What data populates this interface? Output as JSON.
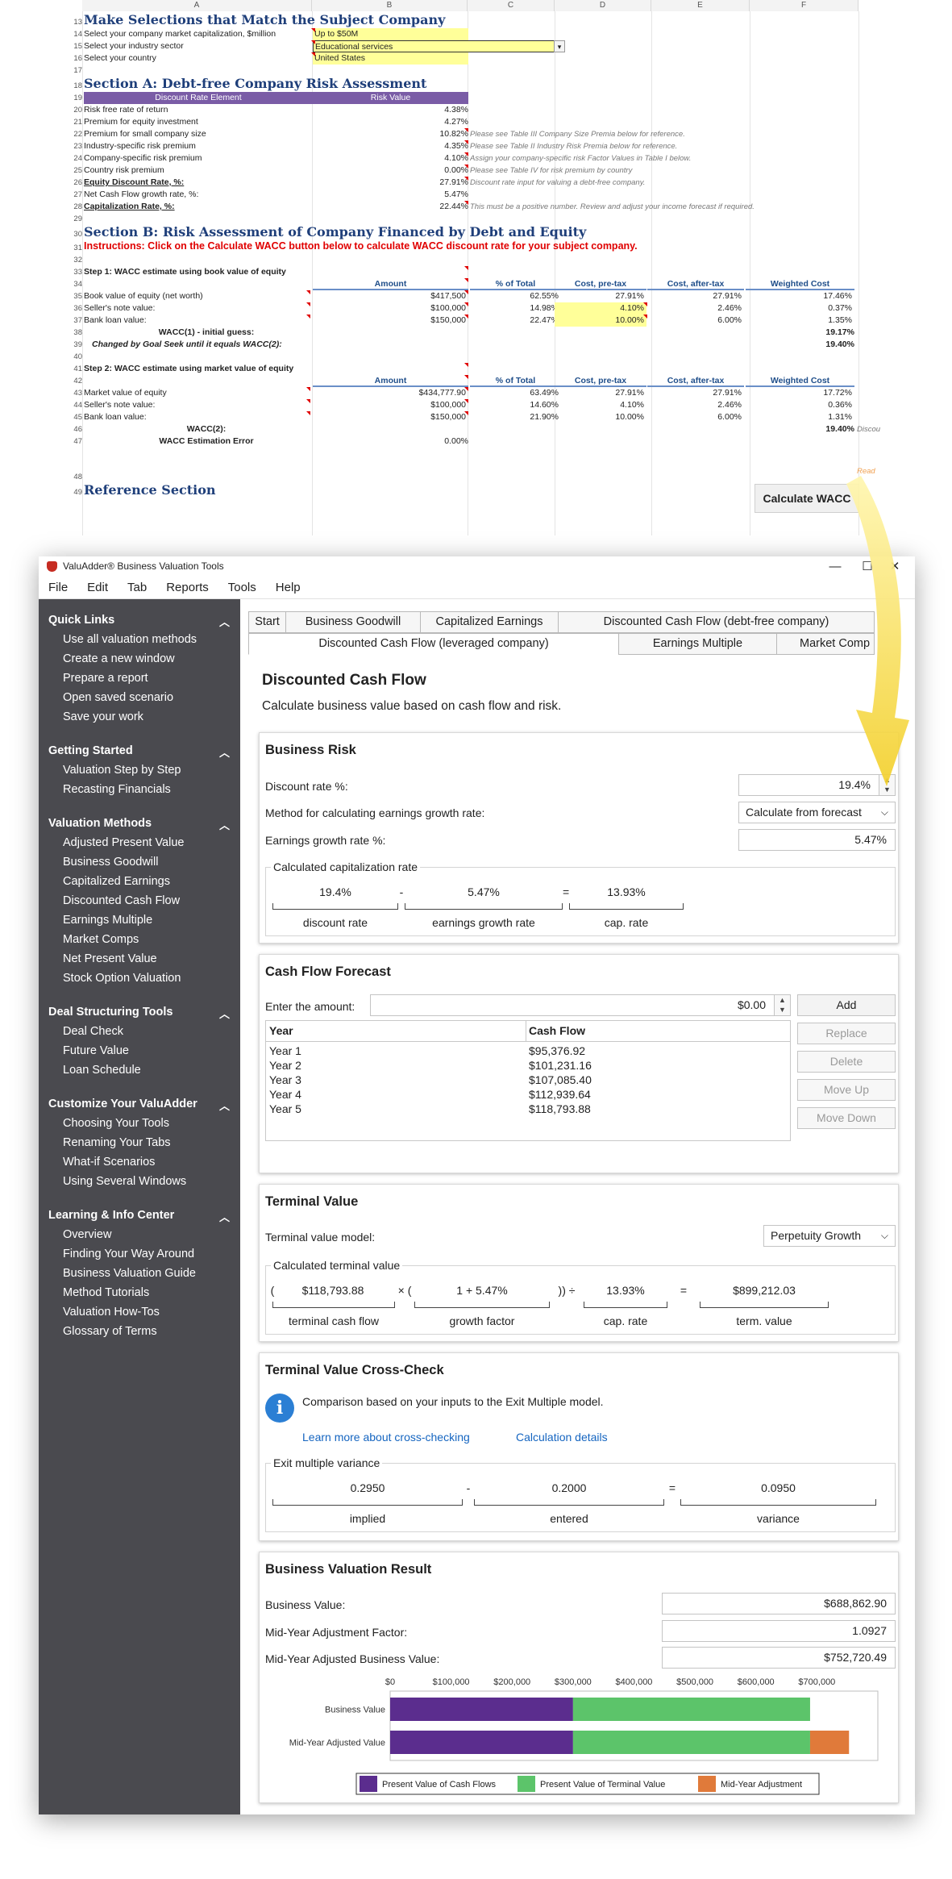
{
  "sheet": {
    "columns": [
      "A",
      "B",
      "C",
      "D",
      "E",
      "F"
    ],
    "rows": [
      {
        "n": "13",
        "a": "Make Selections that Match the Subject Company",
        "kind": "section"
      },
      {
        "n": "14",
        "a": "Select your company market capitalization, $million",
        "b": "Up to $50M",
        "kind": "select"
      },
      {
        "n": "15",
        "a": "Select your industry sector",
        "b": "Educational services",
        "kind": "select"
      },
      {
        "n": "16",
        "a": "Select your country",
        "b": "United States",
        "kind": "select"
      },
      {
        "n": "17",
        "kind": "blank"
      },
      {
        "n": "18",
        "a": "Section A: Debt-free Company Risk Assessment",
        "kind": "section"
      },
      {
        "n": "19",
        "a": "Discount Rate Element",
        "b": "Risk Value",
        "kind": "phdr"
      },
      {
        "n": "20",
        "a": "Risk free rate of return",
        "b": "4.38%",
        "kind": "val"
      },
      {
        "n": "21",
        "a": "Premium for equity investment",
        "b": "4.27%",
        "kind": "val"
      },
      {
        "n": "22",
        "a": "Premium for small company size",
        "b": "10.82%",
        "c": "Please see Table III Company Size Premia below for reference.",
        "kind": "val"
      },
      {
        "n": "23",
        "a": "Industry-specific risk premium",
        "b": "4.35%",
        "c": "Please see Table II Industry Risk Premia below for reference.",
        "kind": "val"
      },
      {
        "n": "24",
        "a": "Company-specific risk premium",
        "b": "4.10%",
        "c": "Assign your company-specific risk Factor Values in Table I below.",
        "kind": "val"
      },
      {
        "n": "25",
        "a": "Country risk premium",
        "b": "0.00%",
        "c": "Please see Table IV for risk premium by country",
        "kind": "val"
      },
      {
        "n": "26",
        "a": "Equity Discount Rate, %:",
        "b": "27.91%",
        "c": "Discount rate input for valuing a debt-free company.",
        "kind": "valb"
      },
      {
        "n": "27",
        "a": "Net Cash Flow growth rate, %:",
        "b": "5.47%",
        "kind": "val"
      },
      {
        "n": "28",
        "a": "Capitalization Rate, %:",
        "b": "22.44%",
        "c": "This must be a positive number. Review and adjust your income forecast if required.",
        "kind": "valb"
      },
      {
        "n": "29",
        "kind": "blank"
      },
      {
        "n": "30",
        "a": "Section B: Risk Assessment of Company Financed by Debt and Equity",
        "kind": "section"
      },
      {
        "n": "31",
        "a": "Instructions: Click on the Calculate WACC button below to calculate WACC discount rate for your subject company.",
        "kind": "instr"
      },
      {
        "n": "32",
        "kind": "blank"
      },
      {
        "n": "33",
        "a": "Step 1: WACC estimate using book value of equity",
        "kind": "step"
      },
      {
        "n": "34",
        "kind": "hdr",
        "cols": [
          "Amount",
          "% of Total",
          "Cost, pre-tax",
          "Cost, after-tax",
          "Weighted Cost"
        ]
      },
      {
        "n": "35",
        "a": "Book value of equity (net worth)",
        "cols": [
          "$417,500",
          "62.55%",
          "27.91%",
          "27.91%",
          "17.46%"
        ],
        "kind": "data"
      },
      {
        "n": "36",
        "a": "Seller's note value:",
        "cols": [
          "$100,000",
          "14.98%",
          "4.10%",
          "2.46%",
          "0.37%"
        ],
        "kind": "data",
        "yellow": true
      },
      {
        "n": "37",
        "a": "Bank loan value:",
        "cols": [
          "$150,000",
          "22.47%",
          "10.00%",
          "6.00%",
          "1.35%"
        ],
        "kind": "data",
        "yellow": true
      },
      {
        "n": "38",
        "a": "WACC(1) - initial guess:",
        "f": "19.17%",
        "kind": "wacc"
      },
      {
        "n": "39",
        "a": "Changed by Goal Seek until it equals WACC(2):",
        "f": "19.40%",
        "kind": "waccit"
      },
      {
        "n": "40",
        "kind": "blank"
      },
      {
        "n": "41",
        "a": "Step 2: WACC estimate using market value of equity",
        "kind": "step"
      },
      {
        "n": "42",
        "kind": "hdr",
        "cols": [
          "Amount",
          "% of Total",
          "Cost, pre-tax",
          "Cost, after-tax",
          "Weighted Cost"
        ]
      },
      {
        "n": "43",
        "a": "Market value of equity",
        "cols": [
          "$434,777.90",
          "63.49%",
          "27.91%",
          "27.91%",
          "17.72%"
        ],
        "kind": "data"
      },
      {
        "n": "44",
        "a": "Seller's note value:",
        "cols": [
          "$100,000",
          "14.60%",
          "4.10%",
          "2.46%",
          "0.36%"
        ],
        "kind": "data"
      },
      {
        "n": "45",
        "a": "Bank loan value:",
        "cols": [
          "$150,000",
          "21.90%",
          "10.00%",
          "6.00%",
          "1.31%"
        ],
        "kind": "data"
      },
      {
        "n": "46",
        "a": "WACC(2):",
        "f": "19.40%",
        "g": "Discou",
        "kind": "wacc"
      },
      {
        "n": "47",
        "a": "WACC Estimation Error",
        "b": "0.00%",
        "kind": "waccerr"
      },
      {
        "n": "48",
        "kind": "btnrow",
        "g": "Read"
      },
      {
        "n": "49",
        "a": "Reference Section",
        "kind": "section"
      }
    ],
    "wacc_button": "Calculate WACC"
  },
  "app": {
    "title": "ValuAdder® Business Valuation Tools",
    "window_controls": [
      "—",
      "☐",
      "✕"
    ],
    "menu": [
      "File",
      "Edit",
      "Tab",
      "Reports",
      "Tools",
      "Help"
    ],
    "sidebar": [
      {
        "group": "Quick Links",
        "items": [
          "Use all valuation methods",
          "Create a new window",
          "Prepare a report",
          "Open saved scenario",
          "Save your work"
        ]
      },
      {
        "group": "Getting Started",
        "items": [
          "Valuation Step by Step",
          "Recasting Financials"
        ]
      },
      {
        "group": "Valuation Methods",
        "items": [
          "Adjusted Present Value",
          "Business Goodwill",
          "Capitalized Earnings",
          "Discounted Cash Flow",
          "Earnings Multiple",
          "Market Comps",
          "Net Present Value",
          "Stock Option Valuation"
        ]
      },
      {
        "group": "Deal Structuring Tools",
        "items": [
          "Deal Check",
          "Future Value",
          "Loan Schedule"
        ]
      },
      {
        "group": "Customize Your ValuAdder",
        "items": [
          "Choosing Your Tools",
          "Renaming Your Tabs",
          "What-if Scenarios",
          "Using Several Windows"
        ]
      },
      {
        "group": "Learning & Info Center",
        "items": [
          "Overview",
          "Finding Your Way Around",
          "Business Valuation Guide",
          "Method Tutorials",
          "Valuation How-Tos",
          "Glossary of Terms"
        ]
      }
    ],
    "tabs_row1": [
      "Start",
      "Business Goodwill",
      "Capitalized Earnings",
      "Discounted Cash Flow (debt-free company)"
    ],
    "tabs_row2": [
      "Discounted Cash Flow (leveraged company)",
      "Earnings Multiple",
      "Market Comp"
    ],
    "page_title": "Discounted Cash Flow",
    "page_subtitle": "Calculate business value based on cash flow and risk.",
    "risk": {
      "title": "Business Risk",
      "discount_label": "Discount rate %:",
      "discount_value": "19.4%",
      "method_label": "Method for calculating earnings growth rate:",
      "method_value": "Calculate from forecast",
      "growth_label": "Earnings growth rate %:",
      "growth_value": "5.47%",
      "cap_caption": "Calculated capitalization rate",
      "cap_values": [
        "19.4%",
        "5.47%",
        "13.93%"
      ],
      "cap_ops": [
        "-",
        "="
      ],
      "cap_labels": [
        "discount rate",
        "earnings growth rate",
        "cap. rate"
      ]
    },
    "cashflow": {
      "title": "Cash Flow Forecast",
      "amount_label": "Enter the amount:",
      "amount_value": "$0.00",
      "buttons": [
        "Add",
        "Replace",
        "Delete",
        "Move Up",
        "Move Down"
      ],
      "headers": [
        "Year",
        "Cash Flow"
      ],
      "rows": [
        [
          "Year 1",
          "$95,376.92"
        ],
        [
          "Year 2",
          "$101,231.16"
        ],
        [
          "Year 3",
          "$107,085.40"
        ],
        [
          "Year 4",
          "$112,939.64"
        ],
        [
          "Year 5",
          "$118,793.88"
        ]
      ]
    },
    "terminal": {
      "title": "Terminal Value",
      "model_label": "Terminal value model:",
      "model_value": "Perpetuity Growth",
      "caption": "Calculated terminal value",
      "values": [
        "$118,793.88",
        "1 + 5.47%",
        "13.93%",
        "$899,212.03"
      ],
      "ops": [
        "(",
        "× (",
        ")) ÷",
        "="
      ],
      "labels": [
        "terminal cash flow",
        "growth factor",
        "cap. rate",
        "term. value"
      ]
    },
    "crosscheck": {
      "title": "Terminal Value Cross-Check",
      "info_glyph": "i",
      "message": "Comparison based on your inputs to the Exit Multiple model.",
      "link1": "Learn more about cross-checking",
      "link2": "Calculation details",
      "caption": "Exit multiple variance",
      "values": [
        "0.2950",
        "0.2000",
        "0.0950"
      ],
      "ops": [
        "-",
        "="
      ],
      "labels": [
        "implied",
        "entered",
        "variance"
      ]
    },
    "result": {
      "title": "Business Valuation Result",
      "bv_label": "Business Value:",
      "bv_value": "$688,862.90",
      "mid_label": "Mid-Year Adjustment Factor:",
      "mid_value": "1.0927",
      "adj_label": "Mid-Year Adjusted Business Value:",
      "adj_value": "$752,720.49"
    }
  },
  "chart_data": {
    "type": "bar",
    "orientation": "horizontal",
    "stacked": true,
    "categories": [
      "Business Value",
      "Mid-Year Adjusted Value"
    ],
    "series": [
      {
        "name": "Present Value of Cash Flows",
        "color": "#5b2d8e",
        "values": [
          300000,
          300000
        ]
      },
      {
        "name": "Present Value of Terminal Value",
        "color": "#5cc46a",
        "values": [
          388862.9,
          388862.9
        ]
      },
      {
        "name": "Mid-Year Adjustment",
        "color": "#e07a3a",
        "values": [
          0,
          63857.59
        ]
      }
    ],
    "xticks": [
      "$0",
      "$100,000",
      "$200,000",
      "$300,000",
      "$400,000",
      "$500,000",
      "$600,000",
      "$700,000"
    ],
    "xlim": [
      0,
      800000
    ],
    "legend": "bottom",
    "grid": false
  }
}
